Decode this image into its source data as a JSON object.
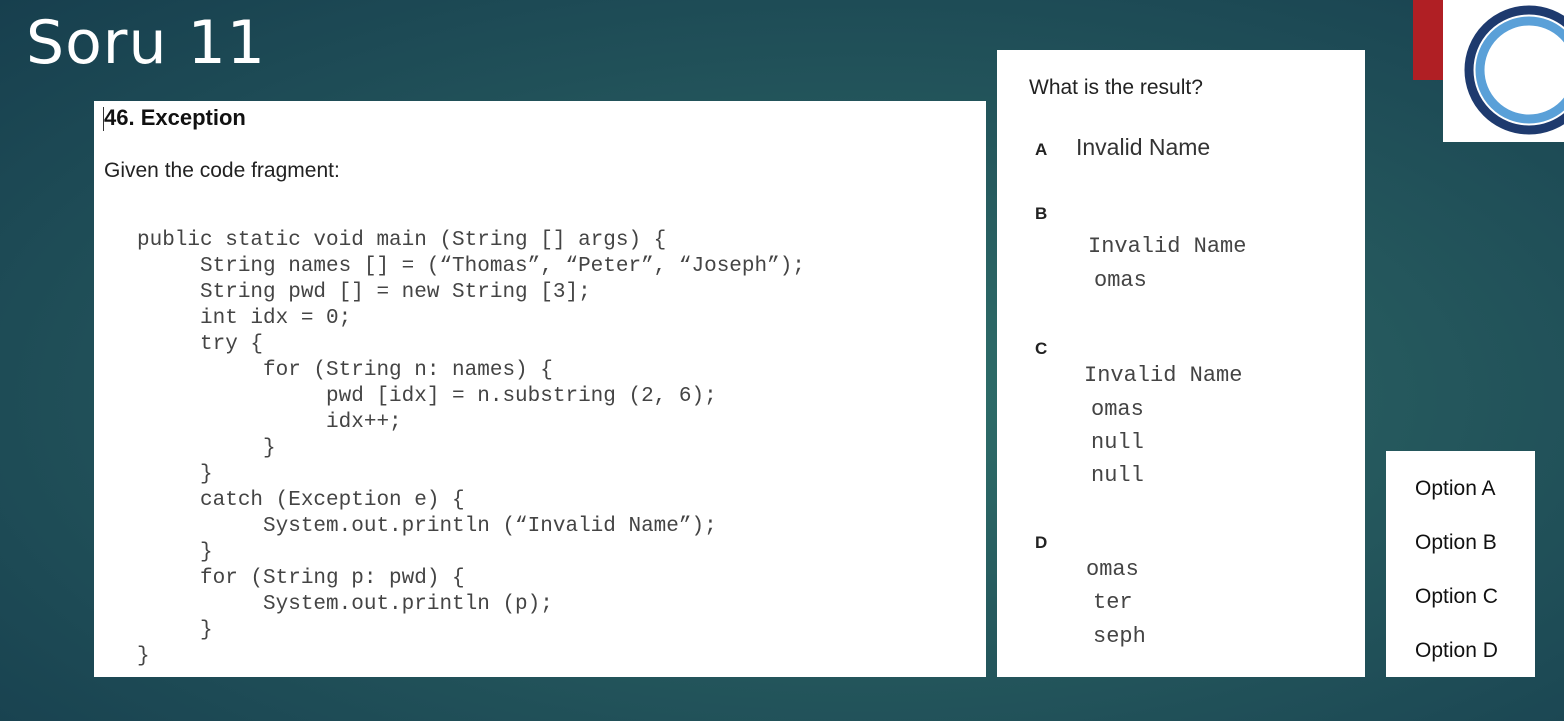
{
  "slide": {
    "title": "Soru 11"
  },
  "question": {
    "heading": "46. Exception",
    "intro": "Given the code fragment:",
    "code_lines": [
      "public static void main (String [] args) {",
      "     String names [] = (“Thomas”, “Peter”, “Joseph”);",
      "     String pwd [] = new String [3];",
      "     int idx = 0;",
      "     try {",
      "          for (String n: names) {",
      "               pwd [idx] = n.substring (2, 6);",
      "               idx++;",
      "          }",
      "     }",
      "     catch (Exception e) {",
      "          System.out.println (“Invalid Name”);",
      "     }",
      "     for (String p: pwd) {",
      "          System.out.println (p);",
      "     }",
      "}"
    ]
  },
  "answers": {
    "question": "What is the result?",
    "options": [
      {
        "letter": "A",
        "lines": [
          "Invalid Name"
        ]
      },
      {
        "letter": "B",
        "lines": [
          "Invalid Name",
          "omas"
        ]
      },
      {
        "letter": "C",
        "lines": [
          "Invalid Name",
          "omas",
          "null",
          "null"
        ]
      },
      {
        "letter": "D",
        "lines": [
          "omas",
          "ter",
          "seph"
        ]
      }
    ]
  },
  "choices": [
    "Option A",
    "Option B",
    "Option C",
    "Option D"
  ],
  "colors": {
    "accent_red": "#b01f24",
    "logo_blue": "#1e3a6e",
    "logo_light_blue": "#5aa0d8"
  },
  "icons": {
    "logo": "ring-logo-icon"
  }
}
